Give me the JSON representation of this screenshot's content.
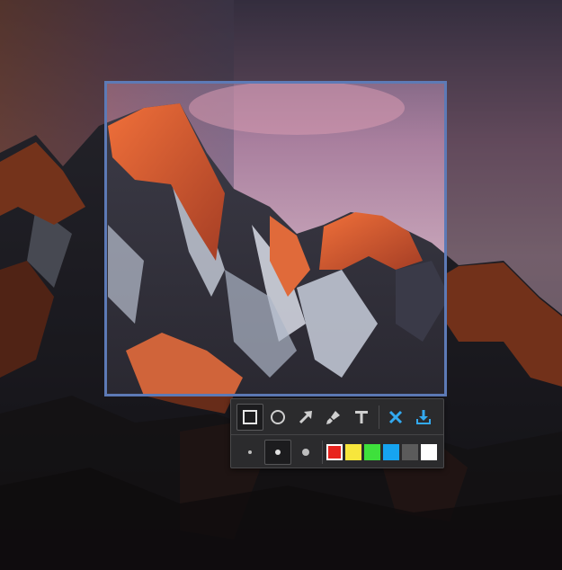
{
  "colors": {
    "selection_border": "#5d7ab6",
    "toolbar_background": "#2b2b2d",
    "accent": "#33aaf0"
  },
  "toolbar": {
    "tools": [
      {
        "icon": "rectangle-icon",
        "active": true
      },
      {
        "icon": "ellipse-icon",
        "active": false
      },
      {
        "icon": "arrow-icon",
        "active": false
      },
      {
        "icon": "brush-icon",
        "active": false
      },
      {
        "icon": "text-icon",
        "glyph": "T",
        "active": false
      }
    ],
    "actions": [
      {
        "icon": "close-icon"
      },
      {
        "icon": "download-icon"
      }
    ],
    "sizes": [
      {
        "name": "small",
        "active": false
      },
      {
        "name": "medium",
        "active": true
      },
      {
        "name": "large",
        "active": false
      }
    ],
    "palette": [
      "#e8231e",
      "#f7e63c",
      "#3ee03c",
      "#16a4f0",
      "#5b5b5b",
      "#ffffff"
    ],
    "selected_color": "#e8231e"
  }
}
